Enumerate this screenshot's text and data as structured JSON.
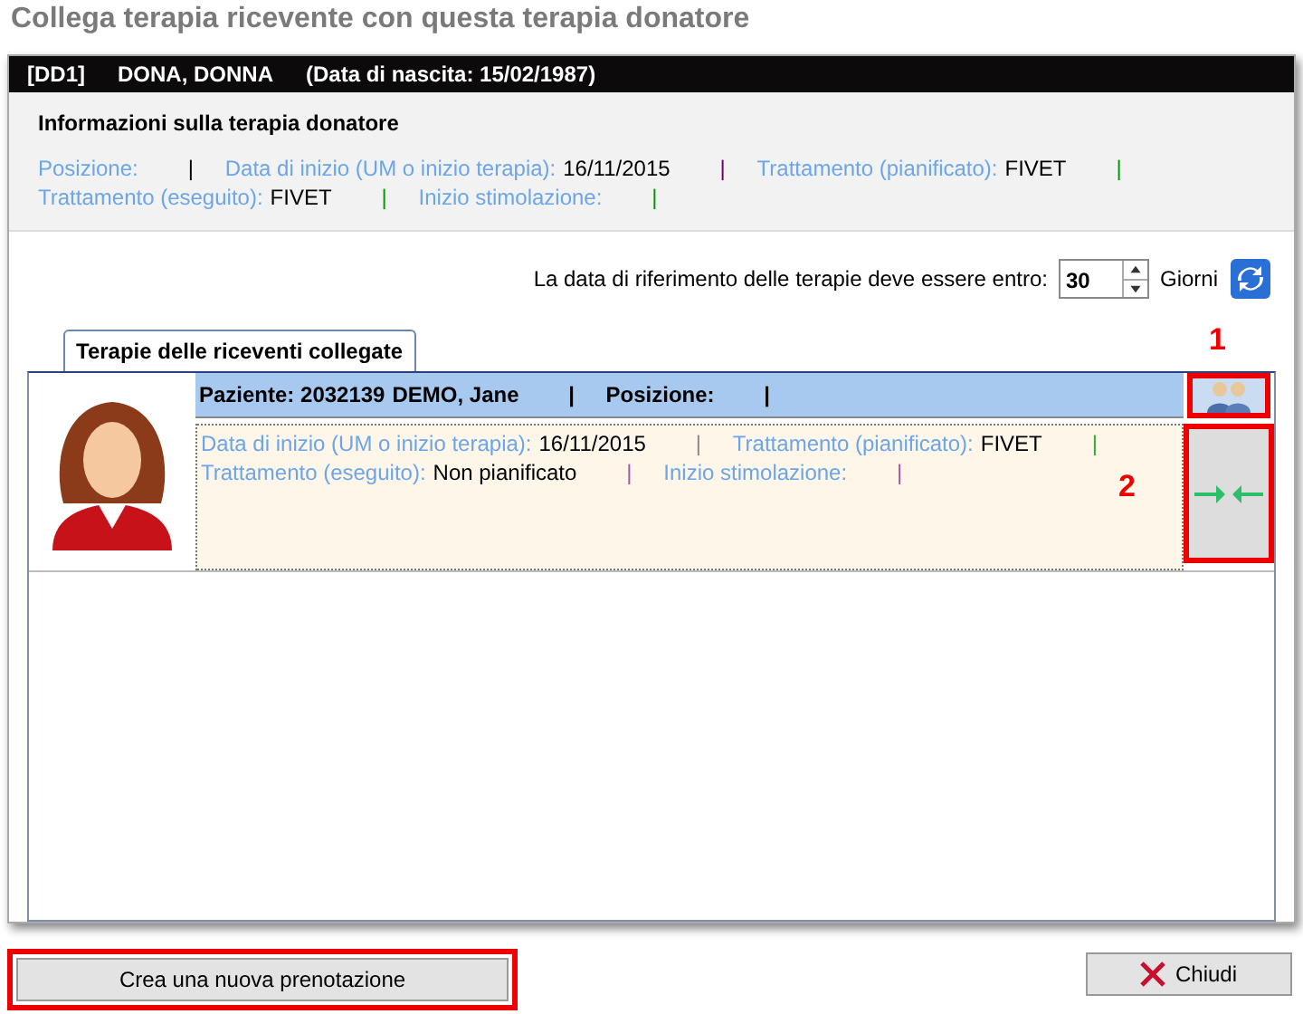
{
  "window": {
    "title": "Collega terapia ricevente con questa terapia donatore"
  },
  "donor": {
    "code": "[DD1]",
    "name": "DONA, DONNA",
    "birth": "(Data di nascita: 15/02/1987)"
  },
  "donor_info": {
    "heading": "Informazioni sulla terapia donatore",
    "lines": [
      [
        {
          "label": "Posizione:",
          "sep": "|",
          "color": "#000000"
        },
        {
          "label": "Data di inizio (UM o inizio terapia):",
          "value": "16/11/2015",
          "sep": "|",
          "color": "#660066"
        },
        {
          "label": "Trattamento (pianificato):",
          "value": "FIVET",
          "sep": "|",
          "color": "#009900"
        }
      ],
      [
        {
          "label": "Trattamento (eseguito):",
          "value": "FIVET",
          "sep": "|",
          "color": "#009900"
        },
        {
          "label": "Inizio stimolazione:",
          "sep": "|",
          "color": "#009900"
        }
      ]
    ]
  },
  "range": {
    "label": "La data di riferimento delle terapie deve essere entro:",
    "value": "30",
    "unit": "Giorni"
  },
  "tabs": [
    {
      "label": "Terapie delle riceventi collegate",
      "selected": true
    }
  ],
  "recipients": [
    {
      "header": [
        {
          "label": "Paziente: 2032139",
          "value": "DEMO, Jane",
          "sep": "|"
        },
        {
          "label": "Posizione:",
          "sep": "|"
        }
      ],
      "lines": [
        [
          {
            "label": "Data di inizio (UM o inizio terapia):",
            "value": "16/11/2015",
            "sep": "|",
            "color": "#888888"
          },
          {
            "label": "Trattamento (pianificato):",
            "value": "FIVET",
            "sep": "|",
            "color": "#33aa33"
          }
        ],
        [
          {
            "label": "Trattamento (eseguito):",
            "value": "Non pianificato",
            "sep": "|",
            "color": "#aa55aa"
          },
          {
            "label": "Inizio stimolazione:",
            "sep": "|",
            "color": "#aa55aa"
          }
        ]
      ]
    }
  ],
  "callouts": [
    "1",
    "2"
  ],
  "buttons": [
    {
      "label": "Crea una nuova prenotazione",
      "kind": "plain"
    },
    {
      "label": "Chiudi",
      "kind": "close"
    }
  ]
}
